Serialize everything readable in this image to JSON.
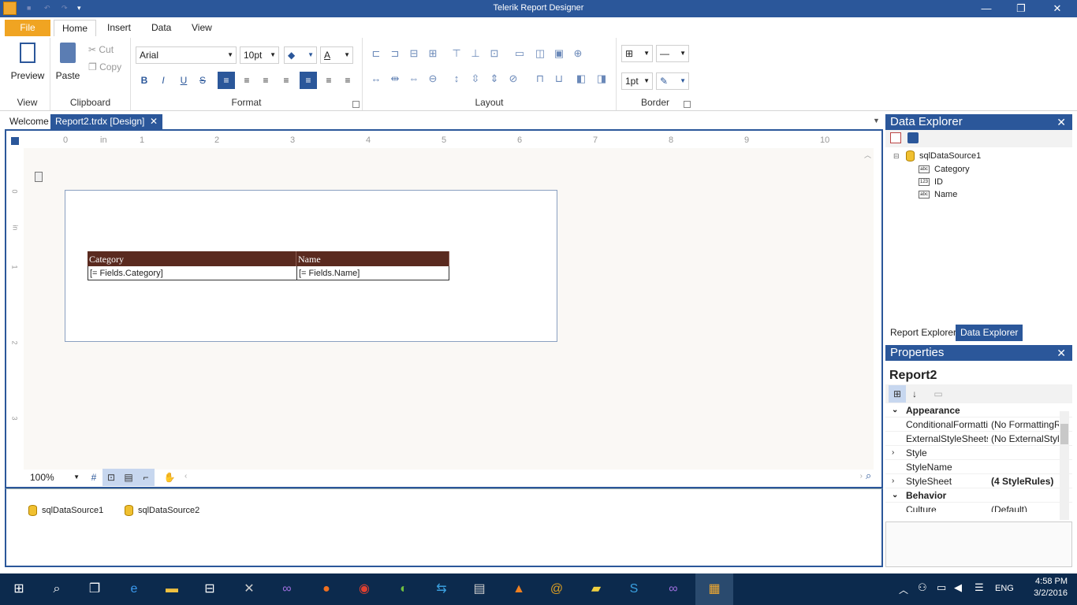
{
  "window": {
    "title": "Telerik Report Designer"
  },
  "ribbon": {
    "tabs": [
      "File",
      "Home",
      "Insert",
      "Data",
      "View"
    ],
    "view_group": {
      "label": "View",
      "preview": "Preview"
    },
    "clipboard_group": {
      "label": "Clipboard",
      "paste": "Paste",
      "cut": "Cut",
      "copy": "Copy"
    },
    "format_group": {
      "label": "Format",
      "font": "Arial",
      "size": "10pt"
    },
    "layout_group": {
      "label": "Layout"
    },
    "border_group": {
      "label": "Border",
      "width": "1pt"
    }
  },
  "doc_tabs": {
    "welcome": "Welcome",
    "active": "Report2.trdx [Design]"
  },
  "ruler": {
    "h_ticks": [
      "0",
      "in",
      "1",
      "2",
      "3",
      "4",
      "5",
      "6",
      "7",
      "8",
      "9",
      "10"
    ],
    "v_ticks": [
      "0",
      "in",
      "1",
      "2",
      "3"
    ]
  },
  "report_table": {
    "headers": [
      "Category",
      "Name"
    ],
    "cells": [
      "[= Fields.Category]",
      "[= Fields.Name]"
    ]
  },
  "designer_status": {
    "zoom": "100%"
  },
  "data_sources": [
    "sqlDataSource1",
    "sqlDataSource2"
  ],
  "data_explorer": {
    "title": "Data Explorer",
    "source": "sqlDataSource1",
    "fields": [
      "Category",
      "ID",
      "Name"
    ],
    "tabs": [
      "Report Explorer",
      "Data Explorer"
    ]
  },
  "properties": {
    "title": "Properties",
    "object": "Report2",
    "rows": [
      {
        "name": "Appearance",
        "value": "",
        "cat": true
      },
      {
        "name": "ConditionalFormatti",
        "value": "(No FormattingR"
      },
      {
        "name": "ExternalStyleSheets",
        "value": "(No ExternalStyle"
      },
      {
        "name": "Style",
        "value": ""
      },
      {
        "name": "StyleName",
        "value": ""
      },
      {
        "name": "StyleSheet",
        "value": "(4 StyleRules)"
      },
      {
        "name": "Behavior",
        "value": "",
        "cat": true
      },
      {
        "name": "Culture",
        "value": "(Default)"
      }
    ]
  },
  "taskbar": {
    "lang": "ENG",
    "time": "4:58 PM",
    "date": "3/2/2016"
  }
}
